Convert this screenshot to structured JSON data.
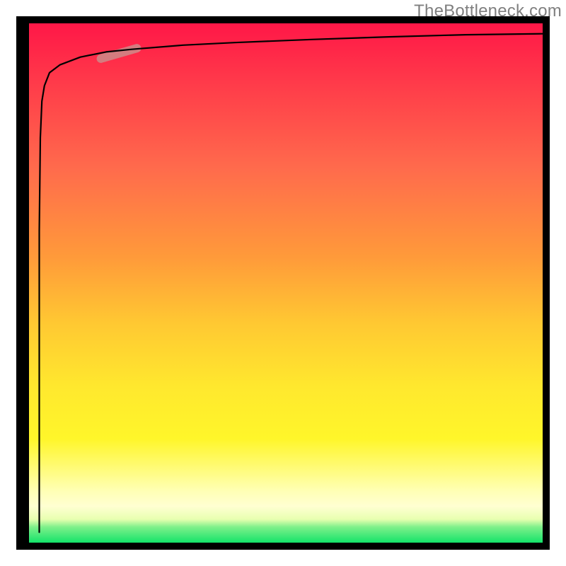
{
  "watermark": "TheBottleneck.com",
  "chart_data": {
    "type": "line",
    "title": "",
    "xlabel": "",
    "ylabel": "",
    "xlim": [
      0,
      100
    ],
    "ylim": [
      0,
      100
    ],
    "grid": false,
    "legend": false,
    "series": [
      {
        "name": "curve",
        "x": [
          2,
          2,
          2.2,
          2.5,
          3,
          4,
          6,
          10,
          15,
          20,
          30,
          40,
          55,
          70,
          85,
          100
        ],
        "values": [
          2,
          60,
          78,
          85,
          88,
          90.5,
          92,
          93.5,
          94.5,
          95,
          95.8,
          96.3,
          96.9,
          97.4,
          97.8,
          98
        ]
      }
    ],
    "marker": {
      "description": "highlighted segment on curve",
      "x_range": [
        14,
        21
      ],
      "y_range": [
        93.2,
        95.2
      ],
      "color": "#cf8585"
    },
    "background": {
      "type": "vertical-gradient",
      "stops": [
        {
          "pos": 0,
          "color": "#ff1747"
        },
        {
          "pos": 45,
          "color": "#ff9a3a"
        },
        {
          "pos": 80,
          "color": "#fff62a"
        },
        {
          "pos": 95,
          "color": "#e8ffb0"
        },
        {
          "pos": 100,
          "color": "#14e36a"
        }
      ]
    }
  }
}
